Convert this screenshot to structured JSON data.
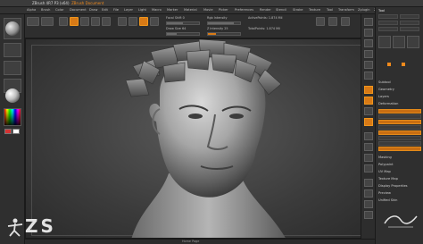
{
  "window": {
    "title": "ZBrush 4R7 P3 (x64)",
    "title_suffix": "ZBrush Document"
  },
  "menubar": {
    "items": [
      "Alpha",
      "Brush",
      "Color",
      "Document",
      "Draw",
      "Edit",
      "File",
      "Layer",
      "Light",
      "Macro",
      "Marker",
      "Material",
      "Movie",
      "Picker",
      "Preferences",
      "Render",
      "Stencil",
      "Stroke",
      "Texture",
      "Tool",
      "Transform",
      "Zplugin",
      "Zscript"
    ]
  },
  "topshelf": {
    "active_points": "ActivePoints: 1.874 Mil",
    "total_points": "TotalPoints: 1.874 Mil",
    "focal_label": "Focal Shift 0",
    "rgb_label": "Rgb Intensity",
    "z_label": "Z Intensity 25",
    "draw_label": "Draw Size 64"
  },
  "righttray": {
    "header": "Tool",
    "items": [
      "Load Tool",
      "Save As",
      "Copy Tool",
      "Paste Tool",
      "Import",
      "Export",
      "Clone",
      "Make PolyMesh3D",
      "GoZ",
      "All",
      "Visible",
      "Lightbox Tools"
    ],
    "section_labels": [
      "Subtool",
      "Geometry",
      "Layers",
      "Deformation",
      "Masking",
      "Polypaint",
      "UV Map",
      "Texture Map",
      "Display Properties",
      "Preview",
      "Unified Skin"
    ]
  },
  "bottombar": {
    "label": "Home Page"
  },
  "logo": {
    "text": "ZS"
  },
  "colors": {
    "accent": "#f08a1c",
    "panel": "#2f2f2f",
    "viewport": "#4a4a4a"
  },
  "icons": [
    "brush-sphere-icon",
    "material-sphere-icon",
    "color-picker-icon",
    "zbrush-logo-icon"
  ]
}
